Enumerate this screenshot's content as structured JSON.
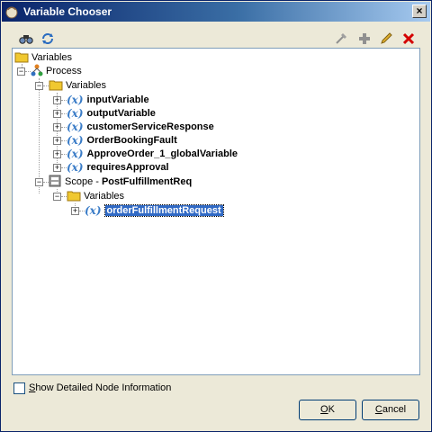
{
  "window": {
    "title": "Variable Chooser",
    "close_label": "×"
  },
  "toolbar": {
    "left": [
      {
        "name": "find-icon"
      },
      {
        "name": "refresh-icon"
      }
    ],
    "right": [
      {
        "name": "edit-schema-icon"
      },
      {
        "name": "add-icon"
      },
      {
        "name": "edit-icon"
      },
      {
        "name": "delete-icon"
      }
    ]
  },
  "tree": {
    "root": "Variables",
    "process": "Process",
    "process_variables": "Variables",
    "variables": [
      "inputVariable",
      "outputVariable",
      "customerServiceResponse",
      "OrderBookingFault",
      "ApproveOrder_1_globalVariable",
      "requiresApproval"
    ],
    "scope_prefix": "Scope - ",
    "scope_name": "PostFulfillmentReq",
    "scope_variables": "Variables",
    "scope_variable": "orderFulfillmentRequest",
    "var_icon": "(x)"
  },
  "options": {
    "show_detailed_first": "S",
    "show_detailed_rest": "how Detailed Node Information",
    "checked": false
  },
  "buttons": {
    "ok_u": "O",
    "ok_rest": "K",
    "cancel_u": "C",
    "cancel_rest": "ancel"
  },
  "colors": {
    "accent": "#0a246a",
    "selection": "#316ac5",
    "var_icon": "#3a7cc7",
    "folder": "#f0c830",
    "delete": "#d40000",
    "add": "#3c9c3c"
  }
}
